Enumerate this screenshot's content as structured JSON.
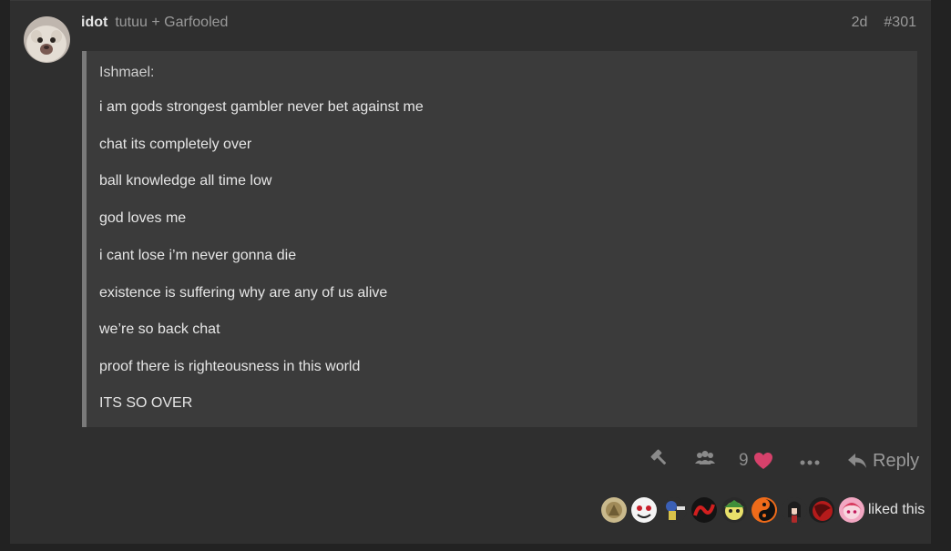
{
  "post": {
    "username": "idot",
    "fullname": "tutuu + Garfooled",
    "age": "2d",
    "number": "#301"
  },
  "quote": {
    "author": "Ishmael:",
    "lines": [
      "i am gods strongest gambler never bet against me",
      "chat its completely over",
      "ball knowledge all time low",
      "god loves me",
      "i cant lose i’m never gonna die",
      "existence is suffering why are any of us alive",
      "we’re so back chat",
      "proof there is righteousness in this world",
      "ITS SO OVER"
    ]
  },
  "actions": {
    "like_count": "9",
    "reply_label": "Reply",
    "icons": [
      "hammer-icon",
      "group-icon",
      "heart-icon",
      "more-icon",
      "reply-icon"
    ],
    "heart_color": "#d6416b"
  },
  "likes": {
    "label": "liked this",
    "avatars": [
      "liker-avatar-1",
      "liker-avatar-2",
      "liker-avatar-3",
      "liker-avatar-4",
      "liker-avatar-5",
      "liker-avatar-6",
      "liker-avatar-7",
      "liker-avatar-8",
      "liker-avatar-9"
    ]
  }
}
